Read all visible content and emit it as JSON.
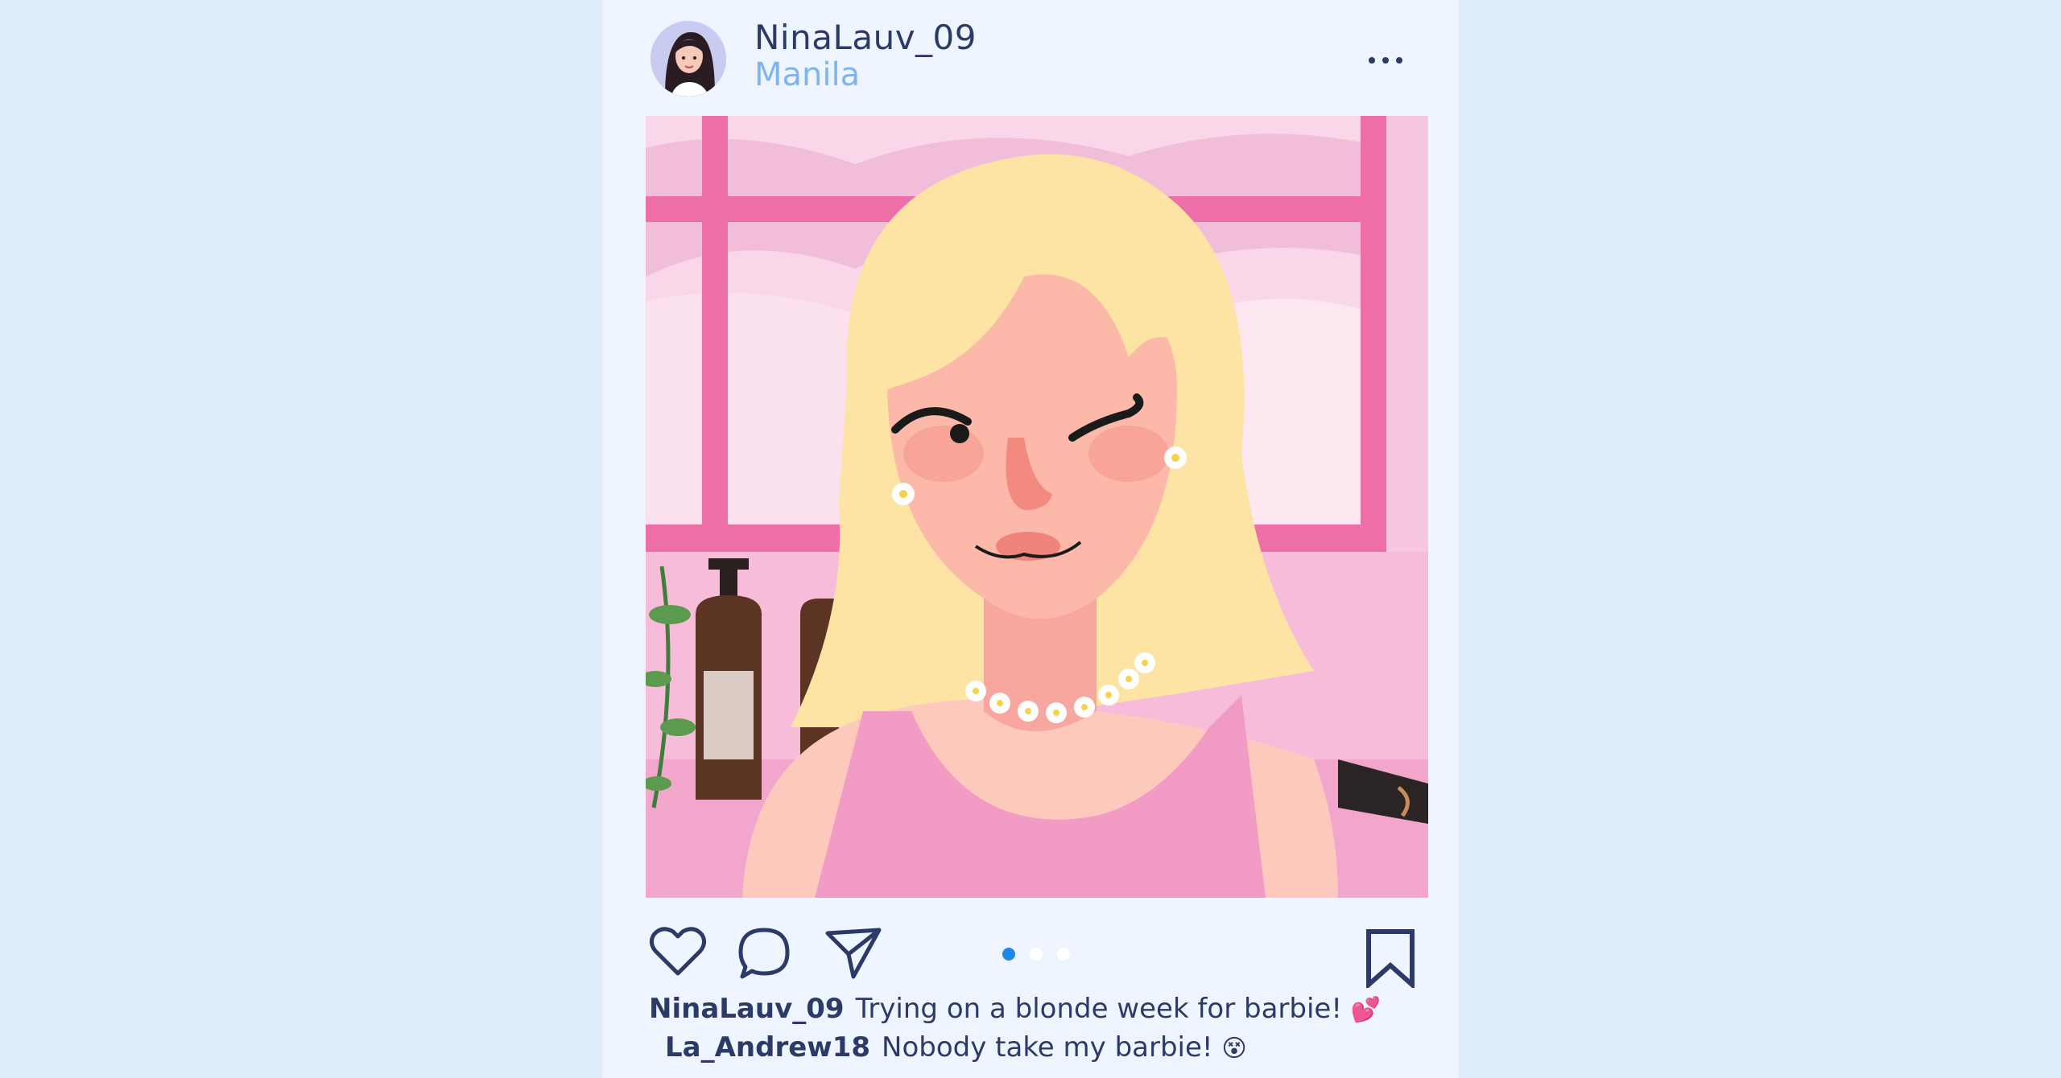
{
  "post": {
    "username": "NinaLauv_09",
    "location": "Manila",
    "avatar_icon": "profile-avatar",
    "more_icon": "more-horizontal-icon",
    "carousel": {
      "count": 3,
      "active_index": 0
    },
    "actions": [
      "heart-icon",
      "comment-icon",
      "share-icon",
      "bookmark-icon"
    ]
  },
  "caption": {
    "author": "NinaLauv_09",
    "text": "Trying on a blonde week for barbie!",
    "emoji": "💕"
  },
  "comment": {
    "author": "La_Andrew18",
    "text": "Nobody take my barbie!",
    "emoji": "😵"
  },
  "colors": {
    "page_bg": "#e0edfd",
    "card_bg": "#eff5fe",
    "text": "#2b3a67",
    "location": "#7fb5ee",
    "carousel_active": "#1e88e5",
    "photo_pink": "#f2a2c9"
  }
}
